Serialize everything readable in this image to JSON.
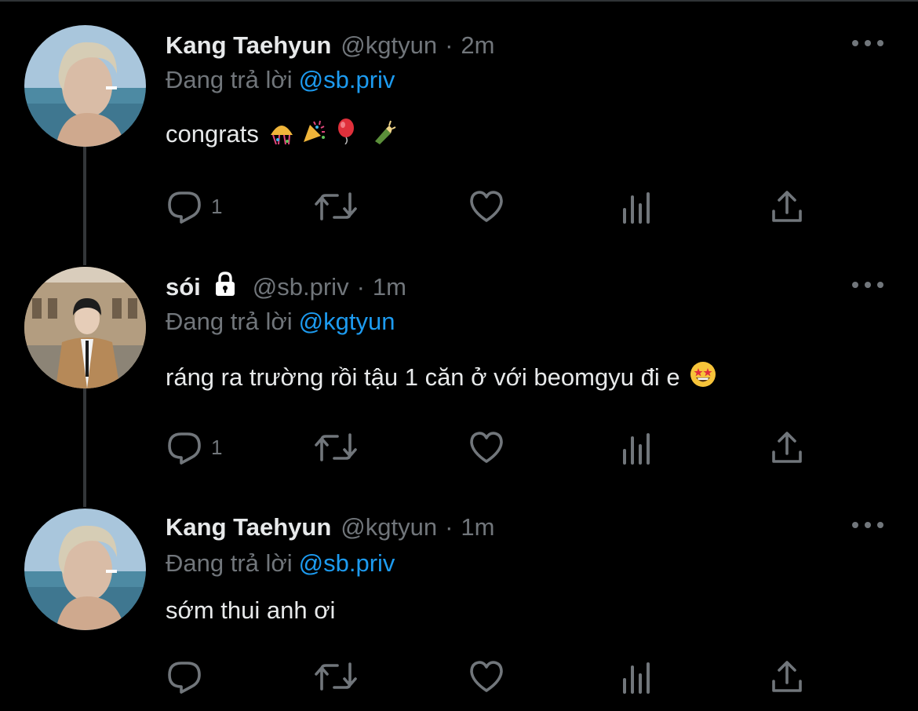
{
  "colors": {
    "background": "#000000",
    "primary_text": "#e7e9ea",
    "secondary_text": "#71767b",
    "mention": "#1d9bf0",
    "thread_line": "#333639"
  },
  "reply_prefix": "Đang trả lời",
  "tweets": [
    {
      "name": "Kang Taehyun",
      "handle": "@kgtyun",
      "separator": "·",
      "time": "2m",
      "locked": false,
      "reply_to": "@sb.priv",
      "text": "congrats",
      "emojis": [
        "confetti-ball",
        "party-popper",
        "balloon",
        "champagne-bottle"
      ],
      "reply_count": "1"
    },
    {
      "name": "sói",
      "handle": "@sb.priv",
      "separator": "·",
      "time": "1m",
      "locked": true,
      "reply_to": "@kgtyun",
      "text": "ráng ra trường rồi tậu 1 căn ở với beomgyu đi e",
      "emojis": [
        "star-struck-face"
      ],
      "reply_count": "1"
    },
    {
      "name": "Kang Taehyun",
      "handle": "@kgtyun",
      "separator": "·",
      "time": "1m",
      "locked": false,
      "reply_to": "@sb.priv",
      "text": "sớm thui anh ơi",
      "emojis": [],
      "reply_count": ""
    }
  ],
  "icons": {
    "reply": "reply-bubble-icon",
    "retweet": "retweet-icon",
    "like": "heart-icon",
    "views": "analytics-icon",
    "share": "share-icon",
    "more": "more-dots-icon",
    "lock": "lock-icon"
  }
}
